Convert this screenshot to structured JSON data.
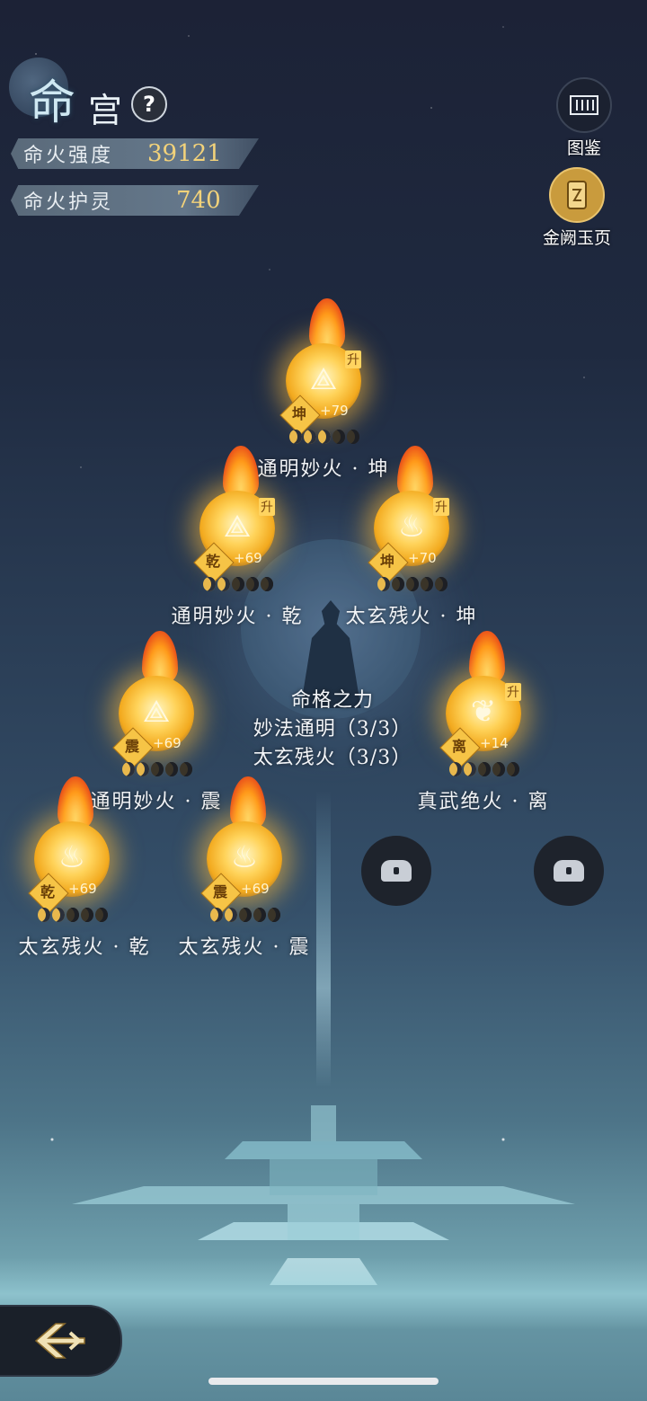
{
  "header": {
    "title_big": "命",
    "title_small": "宫",
    "help_label": "?"
  },
  "stats": [
    {
      "label": "命火强度",
      "value": "39121"
    },
    {
      "label": "命火护灵",
      "value": "740"
    }
  ],
  "side_buttons": [
    {
      "label": "图鉴",
      "icon": "scroll-icon"
    },
    {
      "label": "金阙玉页",
      "icon": "golden-page-icon"
    }
  ],
  "center_panel": {
    "title": "命格之力",
    "line1": "妙法通明（3/3）",
    "line2": "太玄残火（3/3）"
  },
  "nodes": [
    {
      "name": "通明妙火 · 坤",
      "tag": "坤",
      "level": "+79",
      "upgrade": "升",
      "filled": 3,
      "total": 5
    },
    {
      "name": "通明妙火 · 乾",
      "tag": "乾",
      "level": "+69",
      "upgrade": "升",
      "filled": 2,
      "total": 5
    },
    {
      "name": "太玄残火 · 坤",
      "tag": "坤",
      "level": "+70",
      "upgrade": "升",
      "filled": 1,
      "total": 5
    },
    {
      "name": "通明妙火 · 震",
      "tag": "震",
      "level": "+69",
      "upgrade": "",
      "filled": 2,
      "total": 5
    },
    {
      "name": "真武绝火 · 离",
      "tag": "离",
      "level": "+14",
      "upgrade": "升",
      "filled": 2,
      "total": 5
    },
    {
      "name": "太玄残火 · 乾",
      "tag": "乾",
      "level": "+69",
      "upgrade": "",
      "filled": 2,
      "total": 5
    },
    {
      "name": "太玄残火 · 震",
      "tag": "震",
      "level": "+69",
      "upgrade": "",
      "filled": 2,
      "total": 5
    }
  ],
  "locked_slots": 2,
  "colors": {
    "accent_gold": "#f2d27a",
    "flame": "#ff9a1a"
  }
}
